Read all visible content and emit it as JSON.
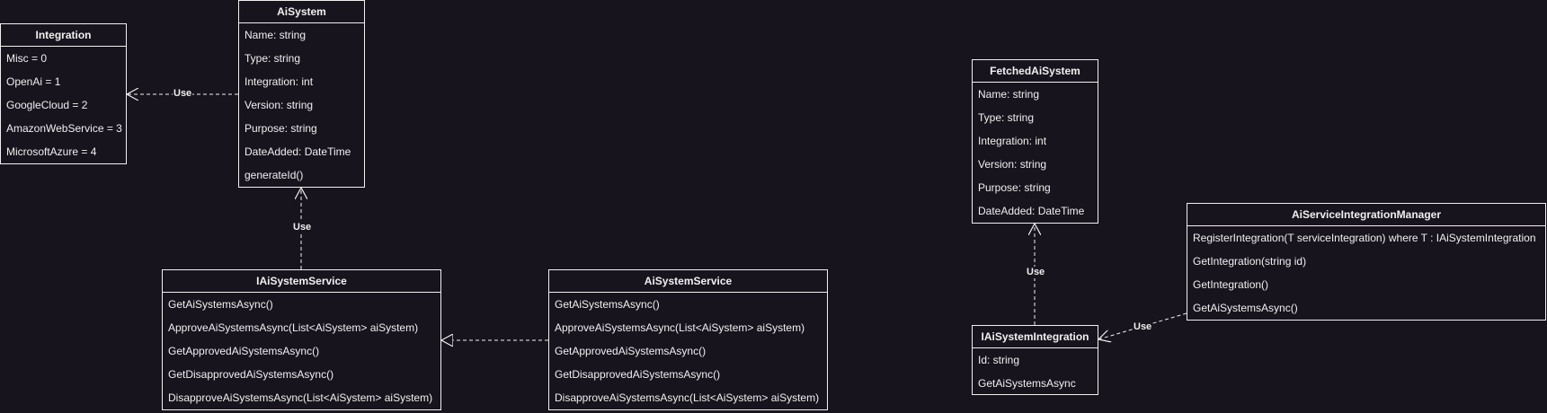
{
  "classes": [
    {
      "id": "integration",
      "title": "Integration",
      "rows": [
        "Misc = 0",
        "OpenAi = 1",
        "GoogleCloud = 2",
        "AmazonWebService = 3",
        "MicrosoftAzure = 4"
      ]
    },
    {
      "id": "ai-system",
      "title": "AiSystem",
      "rows": [
        "Name: string",
        "Type: string",
        "Integration: int",
        "Version: string",
        "Purpose: string",
        "DateAdded: DateTime",
        "generateId()"
      ]
    },
    {
      "id": "iai-system-service",
      "title": "IAiSystemService",
      "rows": [
        "GetAiSystemsAsync()",
        "ApproveAiSystemsAsync(List<AiSystem> aiSystem)",
        "GetApprovedAiSystemsAsync()",
        "GetDisapprovedAiSystemsAsync()",
        "DisapproveAiSystemsAsync(List<AiSystem> aiSystem)"
      ]
    },
    {
      "id": "ai-system-service",
      "title": "AiSystemService",
      "rows": [
        "GetAiSystemsAsync()",
        "ApproveAiSystemsAsync(List<AiSystem> aiSystem)",
        "GetApprovedAiSystemsAsync()",
        "GetDisapprovedAiSystemsAsync()",
        "DisapproveAiSystemsAsync(List<AiSystem> aiSystem)"
      ]
    },
    {
      "id": "fetched-ai-system",
      "title": "FetchedAiSystem",
      "rows": [
        "Name: string",
        "Type: string",
        "Integration: int",
        "Version: string",
        "Purpose: string",
        "DateAdded: DateTime"
      ]
    },
    {
      "id": "iai-system-integration",
      "title": "IAiSystemIntegration",
      "rows": [
        "Id: string",
        "GetAiSystemsAsync"
      ]
    },
    {
      "id": "ai-service-integration-manager",
      "title": "AiServiceIntegrationManager",
      "rows": [
        "RegisterIntegration(T serviceIntegration) where T : IAiSystemIntegration",
        "GetIntegration(string id)",
        "GetIntegration()",
        "GetAiSystemsAsync()"
      ]
    }
  ],
  "relations": [
    {
      "id": "aisystem-uses-integration",
      "kind": "dependency",
      "label": "Use"
    },
    {
      "id": "iaisystemservice-uses-aisystem",
      "kind": "dependency",
      "label": "Use"
    },
    {
      "id": "aisystemservice-implements-iaisystemservice",
      "kind": "realization",
      "label": ""
    },
    {
      "id": "iaisystemintegration-uses-fetchedaisystem",
      "kind": "dependency",
      "label": "Use"
    },
    {
      "id": "manager-uses-iaisystemintegration",
      "kind": "dependency",
      "label": "Use"
    }
  ],
  "colors": {
    "background": "#18141d",
    "line": "#f0f0f0",
    "text": "#f0f0f0"
  }
}
